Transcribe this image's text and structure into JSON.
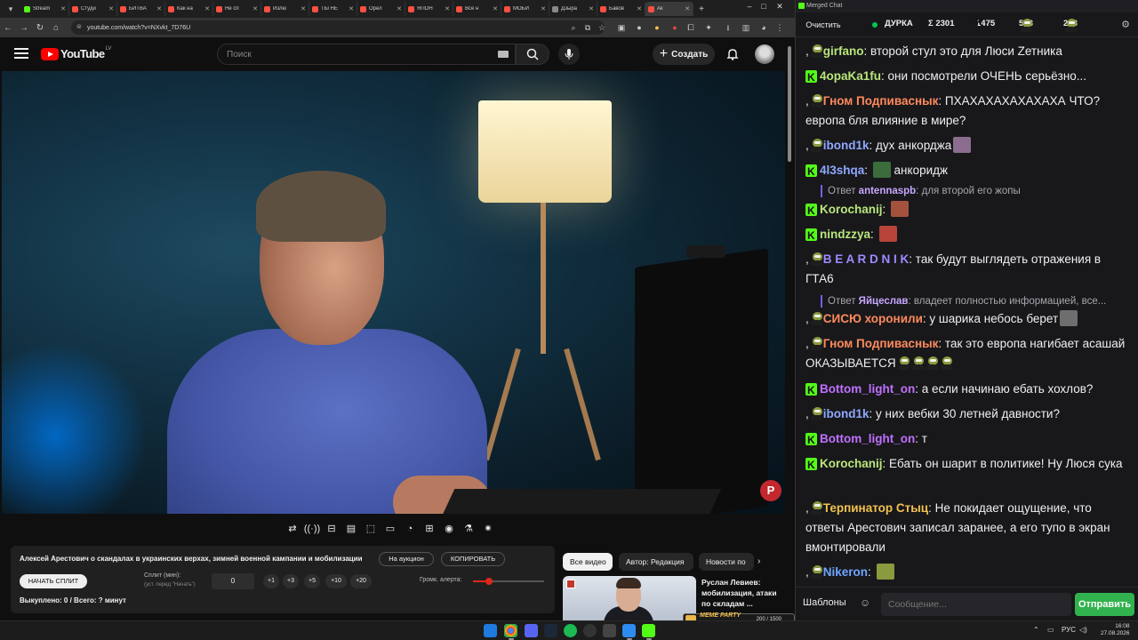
{
  "browser": {
    "tabs": [
      {
        "label": "Stream",
        "color": "#53fc18"
      },
      {
        "label": "Студи",
        "color": "#ff4e45"
      },
      {
        "label": "БИТВА",
        "color": "#ff4e45"
      },
      {
        "label": "Как на",
        "color": "#ff4e45"
      },
      {
        "label": "Не сп",
        "color": "#ff4e45"
      },
      {
        "label": "Излю",
        "color": "#ff4e45"
      },
      {
        "label": "ТЫ НЕ",
        "color": "#ff4e45"
      },
      {
        "label": "Орел",
        "color": "#ff4e45"
      },
      {
        "label": "ЯПОН",
        "color": "#ff4e45"
      },
      {
        "label": "Все н",
        "color": "#ff4e45"
      },
      {
        "label": "МОБИ",
        "color": "#ff4e45"
      },
      {
        "label": "Дзыра",
        "color": "#888888"
      },
      {
        "label": "Бавов",
        "color": "#ff4e45"
      },
      {
        "label": "Ак",
        "color": "#ff4e45"
      }
    ],
    "url": "youtube.com/watch?v=NXvkt_7D76U"
  },
  "youtube": {
    "logo_text": "YouTube",
    "country": "LV",
    "search_placeholder": "Поиск",
    "create_label": "Создать",
    "player_tools": [
      "⇄",
      "((·))",
      "⊟",
      "▤",
      "⬚",
      "▭",
      "◔",
      "⊞",
      "◉",
      "⚗",
      "✷"
    ],
    "chips": [
      {
        "label": "Все видео",
        "active": true
      },
      {
        "label": "Автор: Редакция",
        "active": false
      },
      {
        "label": "Новости по",
        "active": false
      }
    ],
    "related": {
      "title": "Руслан Левиев: мобилизация, атаки по складам ..."
    }
  },
  "auction": {
    "title": "Алексей Арестович о скандалах в украинских верхах, зимней военной кампании и мобилизации",
    "auction_btn": "На аукцион",
    "copy_btn": "КОПИРОВАТЬ",
    "start_btn": "НАЧАТЬ СПЛИТ",
    "split_label": "Сплит (мин):",
    "split_hint": "(уст. перед \"Начать\")",
    "split_value": "0",
    "increments": [
      "+1",
      "+3",
      "+5",
      "+10",
      "+20"
    ],
    "volume_label": "Громк. алерта:",
    "volume_level": 0.22,
    "stats": "Выкуплено: 0 / Всего: ? минут"
  },
  "overlay": {
    "label": "MEME PARTY",
    "count": "200 / 1500"
  },
  "chat": {
    "window_title": "Merged Chat",
    "clear_label": "Очистить",
    "channel": "ДУРКА",
    "sigma_count": "Σ 2301",
    "kick_count": "1475",
    "peepo_count": "578",
    "other_count": "248",
    "messages": [
      {
        "platform": "peepo",
        "user": "girfano",
        "color": "#b9e67a",
        "text": ": второй стул это для Люси Zетника",
        "emote": null
      },
      {
        "platform": "kick",
        "user": "4opaKa1fu",
        "color": "#b9e67a",
        "text": ": они посмотрели ОЧЕНЬ серьёзно...",
        "emote": null
      },
      {
        "platform": "peepo",
        "user": "Гном Подпиваснык",
        "color": "#ff8a5c",
        "text": ": ПХАХАХАХАХАХАХА ЧТО? европа бля влияние в мире?",
        "emote": null
      },
      {
        "platform": "peepo",
        "user": "ibond1k",
        "color": "#8fa8ff",
        "text": ": дух анкорджа",
        "emote": "#8a6d8f"
      },
      {
        "platform": "kick",
        "user": "4l3shqa",
        "color": "#8fa8ff",
        "text": ": ",
        "emote": "#3b6d3c",
        "text2": " анкоридж"
      },
      {
        "platform": "kick",
        "user": "Korochanij",
        "color": "#b9e67a",
        "text": ": ",
        "emote": "#a4523e"
      },
      {
        "platform": "kick",
        "user": "nindzzya",
        "color": "#b9e67a",
        "text": ": ",
        "emote": "#b8443a"
      },
      {
        "platform": "peepo",
        "user": "B E A R D N I K",
        "color": "#9c8cff",
        "text": ": так будут выглядеть отражения в ГТА6",
        "emote": null
      },
      {
        "platform": "peepo",
        "user": "СИСЮ хоронили",
        "color": "#ff8a5c",
        "text": ": у шарика небось берет",
        "emote": "#6e6e6e"
      },
      {
        "platform": "peepo",
        "user": "Гном Подпиваснык",
        "color": "#ff8a5c",
        "text": ": так это европа нагибает асашай ОКАЗЫВАЕТСЯ",
        "emote": null
      },
      {
        "platform": "kick",
        "user": "Bottom_light_on",
        "color": "#c070ff",
        "text": ": а если начинаю ебать хохлов?",
        "emote": null
      },
      {
        "platform": "peepo",
        "user": "ibond1k",
        "color": "#8fa8ff",
        "text": ": у них вебки 30 летней давности?",
        "emote": null
      },
      {
        "platform": "kick",
        "user": "Bottom_light_on",
        "color": "#c070ff",
        "text": ": т",
        "emote": null
      },
      {
        "platform": "kick",
        "user": "Korochanij",
        "color": "#b9e67a",
        "text": ": Ебать он шарит в политике! Ну Люся сука",
        "emote": null
      },
      {
        "platform": "peepo",
        "user": "Терпинатор Стыц",
        "color": "#f2c14e",
        "text": ": Не покидает ощущение, что ответы Арестович записал заранее, а его тупо в экран вмонтировали",
        "emote": null
      },
      {
        "platform": "peepo",
        "user": "Nikeron",
        "color": "#6fa6ff",
        "text": ": ",
        "emote": "#8a9a3e"
      }
    ],
    "replies": [
      {
        "prefix": "Ответ ",
        "user": "antennaspb",
        "text": ": для второй его жопы"
      },
      {
        "prefix": "Ответ ",
        "user": "Яйцеслав",
        "text": ": владеет полностью информацией, все..."
      }
    ],
    "templates_label": "Шаблоны",
    "input_placeholder": "Сообщение...",
    "send_label": "Отправить"
  },
  "taskbar": {
    "lang": "РУС",
    "time": "16:08",
    "date": "27.08.2026"
  }
}
